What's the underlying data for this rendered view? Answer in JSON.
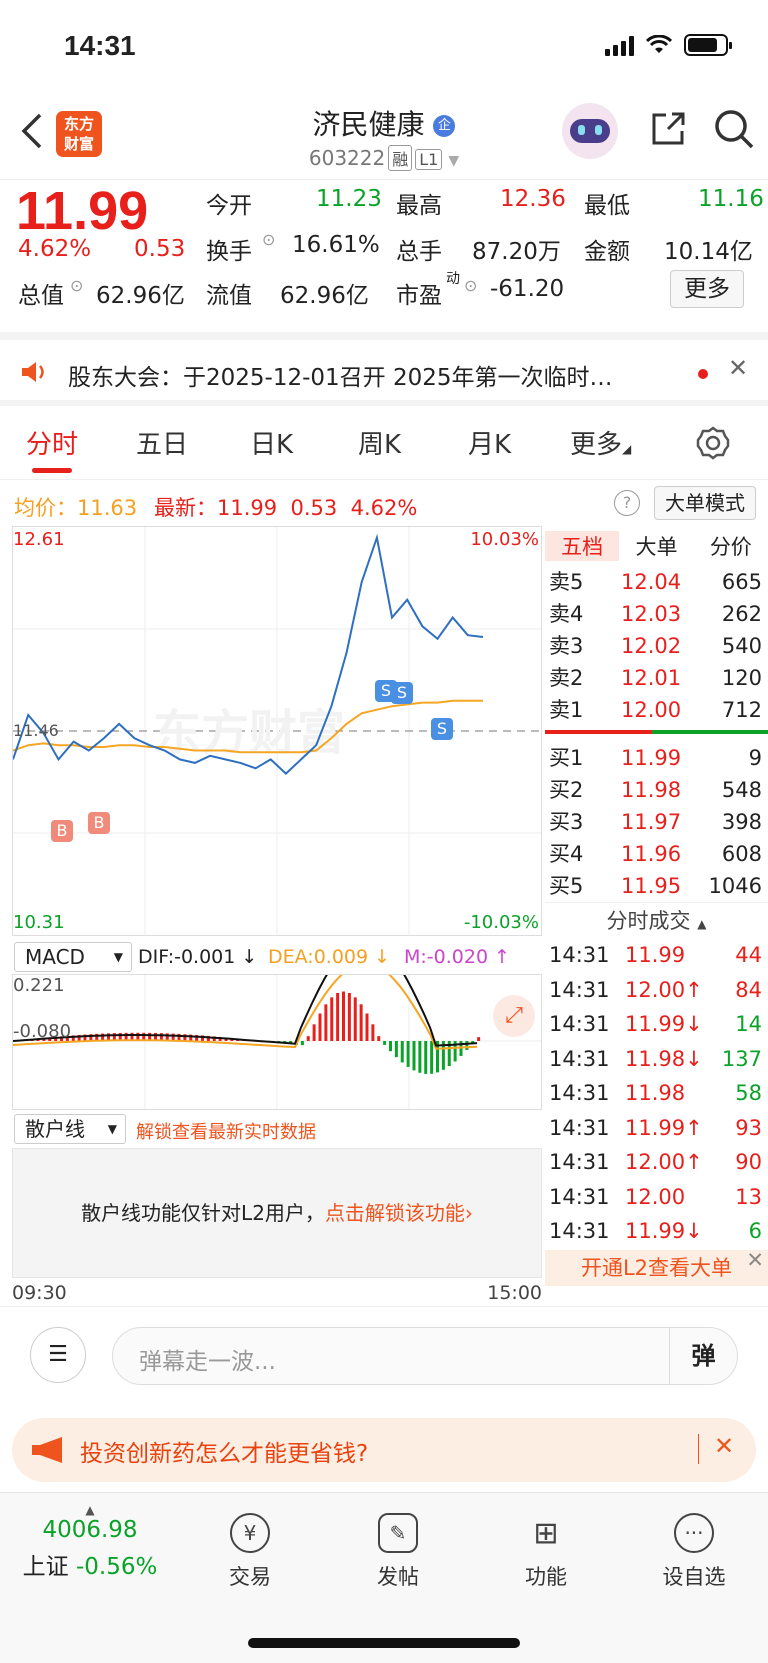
{
  "status": {
    "time": "14:31"
  },
  "header": {
    "logo_line1": "东方",
    "logo_line2": "财富",
    "title": "济民健康",
    "badge": "企",
    "code": "603222",
    "tag1": "融",
    "tag2": "L1"
  },
  "quote": {
    "price": "11.99",
    "change_pct": "4.62%",
    "change": "0.53",
    "open_label": "今开",
    "open": "11.23",
    "high_label": "最高",
    "high": "12.36",
    "low_label": "最低",
    "low": "11.16",
    "turnover_label": "换手",
    "turnover": "16.61%",
    "volume_label": "总手",
    "volume": "87.20万",
    "amount_label": "金额",
    "amount": "10.14亿",
    "mcap_label": "总值",
    "mcap": "62.96亿",
    "float_label": "流值",
    "float": "62.96亿",
    "pe_label": "市盈",
    "pe_sup": "动",
    "pe": "-61.20",
    "more": "更多"
  },
  "notice": {
    "text": "股东大会：于2025-12-01召开 2025年第一次临时…"
  },
  "tabs": [
    "分时",
    "五日",
    "日K",
    "周K",
    "月K",
    "更多"
  ],
  "avg": {
    "avg_label": "均价：",
    "avg": "11.63",
    "latest_label": "最新：",
    "latest": "11.99",
    "chg": "0.53",
    "pct": "4.62%",
    "mode": "大单模式"
  },
  "chart": {
    "ymax": "12.61",
    "ymin": "10.31",
    "pmax": "10.03%",
    "pmin": "-10.03%",
    "prev_close": "11.46",
    "watermark": "东方财富",
    "marker_b": "B",
    "marker_s": "S"
  },
  "chart_data": {
    "type": "line",
    "title": "",
    "x_range": [
      "09:30",
      "15:00"
    ],
    "ylim": [
      10.31,
      12.61
    ],
    "prev_close": 11.46,
    "series": [
      {
        "name": "",
        "values": [
          11.3,
          11.55,
          11.45,
          11.3,
          11.4,
          11.35,
          11.42,
          11.5,
          11.42,
          11.38,
          11.35,
          11.3,
          11.28,
          11.32,
          11.3,
          11.28,
          11.25,
          11.3,
          11.22,
          11.3,
          11.38,
          11.6,
          11.9,
          12.3,
          12.55,
          12.1,
          12.2,
          12.05,
          11.98,
          12.1,
          12.0,
          11.99
        ]
      },
      {
        "name": "均价",
        "values": [
          11.35,
          11.38,
          11.39,
          11.38,
          11.38,
          11.37,
          11.37,
          11.38,
          11.38,
          11.37,
          11.37,
          11.36,
          11.35,
          11.35,
          11.35,
          11.34,
          11.34,
          11.34,
          11.34,
          11.34,
          11.35,
          11.42,
          11.5,
          11.56,
          11.58,
          11.6,
          11.61,
          11.62,
          11.62,
          11.63,
          11.63,
          11.63
        ]
      }
    ]
  },
  "macd": {
    "name": "MACD",
    "dif": "DIF:-0.001 ↓",
    "dea": "DEA:0.009 ↓",
    "m": "M:-0.020 ↑",
    "ymax": "0.221",
    "ymin": "-0.080"
  },
  "sanhu": {
    "name": "散户线",
    "unlock": "解锁查看最新实时数据",
    "msg": "散户线功能仅针对L2用户，",
    "cta": "点击解锁该功能›"
  },
  "axis": {
    "start": "09:30",
    "end": "15:00"
  },
  "book": {
    "tabs": [
      "五档",
      "大单",
      "分价"
    ],
    "asks": [
      {
        "label": "卖5",
        "price": "12.04",
        "vol": "665"
      },
      {
        "label": "卖4",
        "price": "12.03",
        "vol": "262"
      },
      {
        "label": "卖3",
        "price": "12.02",
        "vol": "540"
      },
      {
        "label": "卖2",
        "price": "12.01",
        "vol": "120"
      },
      {
        "label": "卖1",
        "price": "12.00",
        "vol": "712"
      }
    ],
    "bids": [
      {
        "label": "买1",
        "price": "11.99",
        "vol": "9"
      },
      {
        "label": "买2",
        "price": "11.98",
        "vol": "548"
      },
      {
        "label": "买3",
        "price": "11.97",
        "vol": "398"
      },
      {
        "label": "买4",
        "price": "11.96",
        "vol": "608"
      },
      {
        "label": "买5",
        "price": "11.95",
        "vol": "1046"
      }
    ],
    "ticks_title": "分时成交",
    "ticks": [
      {
        "t": "14:31",
        "p": "11.99",
        "v": "44",
        "c": "red"
      },
      {
        "t": "14:31",
        "p": "12.00↑",
        "v": "84",
        "c": "red"
      },
      {
        "t": "14:31",
        "p": "11.99↓",
        "v": "14",
        "c": "green"
      },
      {
        "t": "14:31",
        "p": "11.98↓",
        "v": "137",
        "c": "green"
      },
      {
        "t": "14:31",
        "p": "11.98",
        "v": "58",
        "c": "green"
      },
      {
        "t": "14:31",
        "p": "11.99↑",
        "v": "93",
        "c": "red"
      },
      {
        "t": "14:31",
        "p": "12.00↑",
        "v": "90",
        "c": "red"
      },
      {
        "t": "14:31",
        "p": "12.00",
        "v": "13",
        "c": "red"
      },
      {
        "t": "14:31",
        "p": "11.99↓",
        "v": "6",
        "c": "green"
      }
    ],
    "l2": "开通L2查看大单"
  },
  "danmu": {
    "placeholder": "弹幕走一波...",
    "btn": "弹"
  },
  "ad": {
    "text": "投资创新药怎么才能更省钱?"
  },
  "bottom": {
    "index_value": "4006.98",
    "index_name": "上证",
    "index_pct": "-0.56%",
    "items": [
      "交易",
      "发帖",
      "功能",
      "设自选"
    ]
  }
}
